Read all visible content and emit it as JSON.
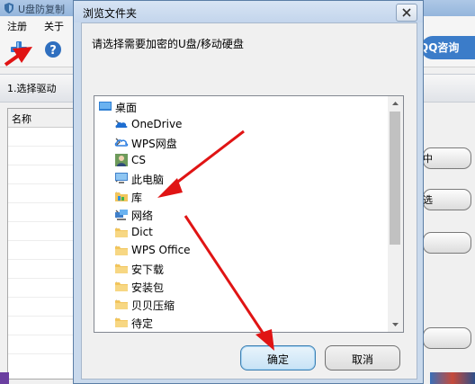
{
  "app": {
    "title": "U盘防复制",
    "menu": [
      "注册",
      "关于"
    ],
    "qq_button": "QQ咨询",
    "step_tab": "1.选择驱动",
    "list_header": "名称",
    "side_buttons": [
      "中",
      "选",
      "",
      ""
    ]
  },
  "dialog": {
    "title": "浏览文件夹",
    "prompt": "请选择需要加密的U盘/移动硬盘",
    "tree_items": [
      {
        "label": "桌面",
        "icon": "desktop-icon",
        "expander": false
      },
      {
        "label": "OneDrive",
        "icon": "onedrive-cloud-icon",
        "expander": true
      },
      {
        "label": "WPS网盘",
        "icon": "wps-cloud-icon",
        "expander": true
      },
      {
        "label": "CS",
        "icon": "user-icon",
        "expander": true
      },
      {
        "label": "此电脑",
        "icon": "computer-icon",
        "expander": true
      },
      {
        "label": "库",
        "icon": "library-icon",
        "expander": true
      },
      {
        "label": "网络",
        "icon": "network-icon",
        "expander": true
      },
      {
        "label": "Dict",
        "icon": "folder-icon",
        "expander": true
      },
      {
        "label": "WPS Office",
        "icon": "folder-icon",
        "expander": true
      },
      {
        "label": "安下载",
        "icon": "folder-icon",
        "expander": true
      },
      {
        "label": "安装包",
        "icon": "folder-icon",
        "expander": true
      },
      {
        "label": "贝贝压缩",
        "icon": "folder-icon",
        "expander": true
      },
      {
        "label": "待定",
        "icon": "folder-icon",
        "expander": true
      }
    ],
    "ok_label": "确定",
    "cancel_label": "取消"
  },
  "colors": {
    "annotation_arrow": "#e01414",
    "folder": "#f2c55c",
    "ok_border": "#3c7fb1"
  }
}
